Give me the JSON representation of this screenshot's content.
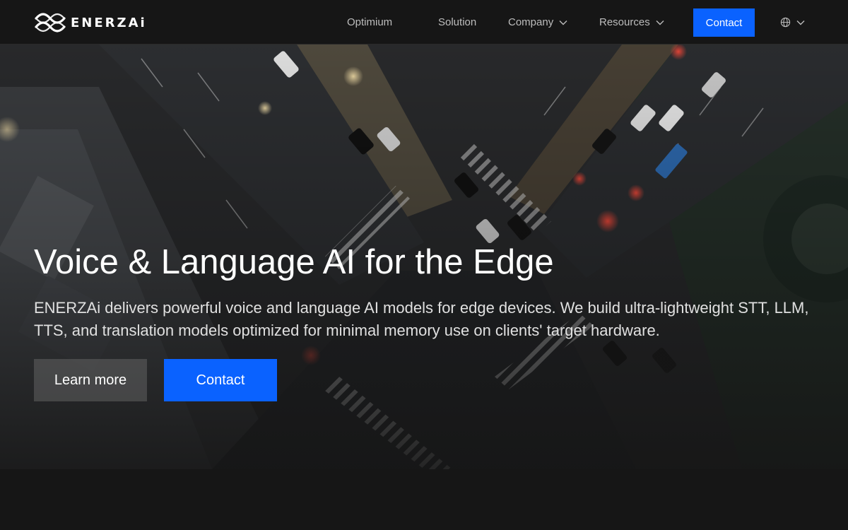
{
  "brand": {
    "name": "ENERZAi",
    "logo_icon": "infinity-wave-logo"
  },
  "nav": {
    "items": [
      {
        "label": "Optimium",
        "has_dropdown": false
      },
      {
        "label": "Solution",
        "has_dropdown": false
      },
      {
        "label": "Company",
        "has_dropdown": true
      },
      {
        "label": "Resources",
        "has_dropdown": true
      }
    ],
    "contact_label": "Contact",
    "language_icon": "globe-icon"
  },
  "hero": {
    "title": "Voice & Language AI for the Edge",
    "description": "ENERZAi delivers powerful voice and language AI models for edge devices. We build ultra-lightweight STT, LLM, TTS, and translation models optimized for minimal memory use on clients' target hardware.",
    "buttons": {
      "learn_more": "Learn more",
      "contact": "Contact"
    },
    "background": "aerial night view of city intersection with traffic"
  },
  "colors": {
    "accent": "#0a62ff",
    "background": "#161616",
    "nav_text": "#bdbdbd"
  }
}
